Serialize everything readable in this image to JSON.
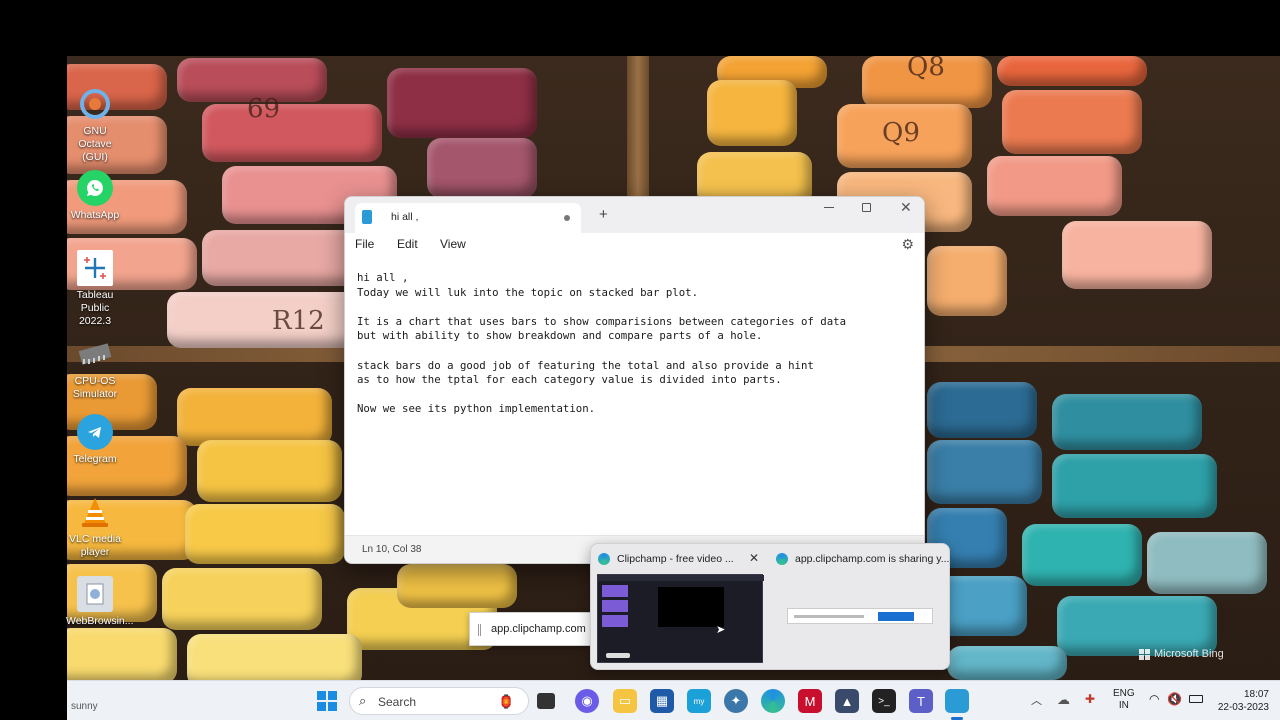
{
  "notepad": {
    "tab_title": "hi all ,",
    "menu": [
      "File",
      "Edit",
      "View"
    ],
    "content": "hi all ,\nToday we will luk into the topic on stacked bar plot.\n\nIt is a chart that uses bars to show comparisions between categories of data\nbut with ability to show breakdown and compare parts of a hole.\n\nstack bars do a good job of featuring the total and also provide a hint\nas to how the tptal for each category value is divided into parts.\n\nNow we see its python implementation.",
    "status_position": "Ln 10, Col 38"
  },
  "desktop_icons": [
    {
      "label": "GNU Octave (GUI)",
      "icon": "octave-icon",
      "color": "#e8f2ff"
    },
    {
      "label": "WhatsApp",
      "icon": "whatsapp-icon",
      "color": "#25d366"
    },
    {
      "label": "Tableau Public 2022.3",
      "icon": "tableau-icon",
      "color": "#ffffff"
    },
    {
      "label": "CPU-OS Simulator",
      "icon": "cpu-icon",
      "color": "#8a8a8a"
    },
    {
      "label": "Telegram",
      "icon": "telegram-icon",
      "color": "#2aa3df"
    },
    {
      "label": "VLC media player",
      "icon": "vlc-icon",
      "color": "#f28c00"
    },
    {
      "label": "WebBrowsin...",
      "icon": "browser-icon",
      "color": "#d9dde4"
    }
  ],
  "wallpaper": {
    "chalk_labels": [
      "69",
      "R12",
      "Q8",
      "Q9"
    ],
    "watermark": "Microsoft Bing"
  },
  "thumbnails": [
    {
      "title": "Clipchamp - free video ...",
      "icon": "edge-icon"
    },
    {
      "title": "app.clipchamp.com is sharing y...",
      "icon": "edge-icon"
    }
  ],
  "share_bar_text": "app.clipchamp.com is s",
  "taskbar": {
    "weather": "sunny",
    "search_label": "Search",
    "language": [
      "ENG",
      "IN"
    ],
    "time": "18:07",
    "date": "22-03-2023"
  }
}
